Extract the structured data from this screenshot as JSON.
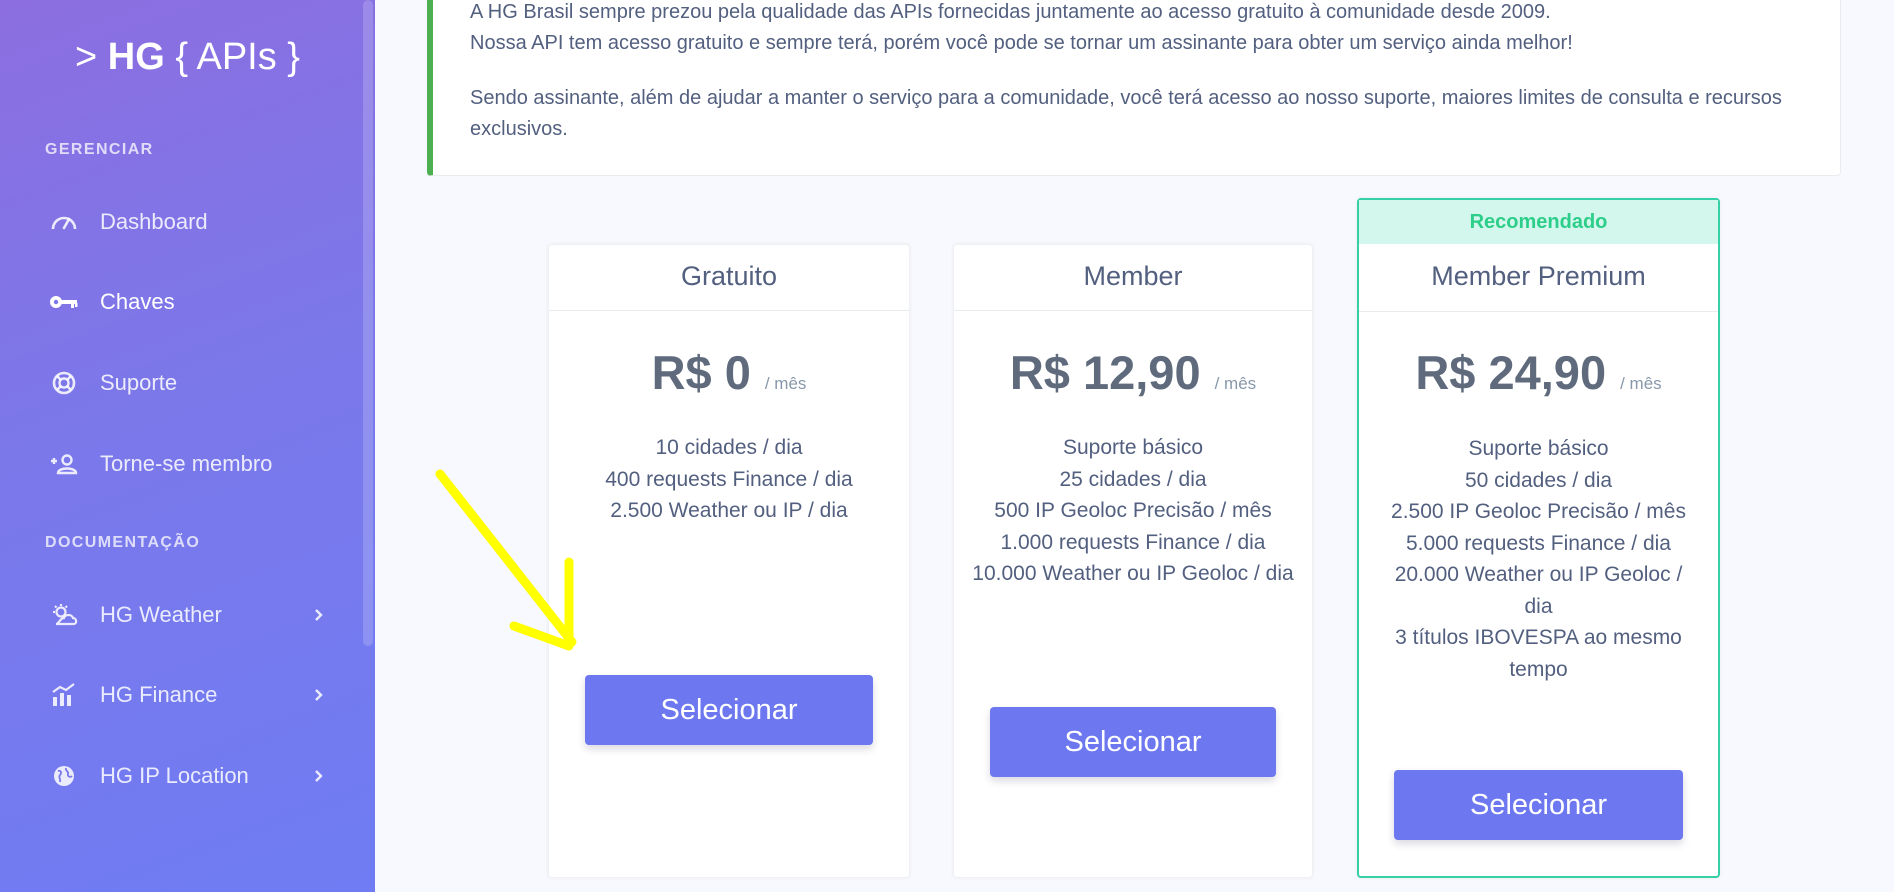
{
  "brand": {
    "prefix": ">",
    "name": "HG",
    "suffix": "{ APIs }"
  },
  "sidebar": {
    "sections": [
      {
        "heading": "GERENCIAR"
      },
      {
        "heading": "DOCUMENTAÇÃO"
      }
    ],
    "items": [
      {
        "label": "Dashboard",
        "icon": "speedometer-icon",
        "active": false
      },
      {
        "label": "Chaves",
        "icon": "key-icon",
        "active": true
      },
      {
        "label": "Suporte",
        "icon": "lifebuoy-icon",
        "active": false
      },
      {
        "label": "Torne-se membro",
        "icon": "user-plus-icon",
        "active": false
      },
      {
        "label": "HG Weather",
        "icon": "weather-icon",
        "expandable": true
      },
      {
        "label": "HG Finance",
        "icon": "finance-chart-icon",
        "expandable": true
      },
      {
        "label": "HG IP Location",
        "icon": "globe-icon",
        "expandable": true
      }
    ]
  },
  "alert": {
    "line1": "A HG Brasil sempre prezou pela qualidade das APIs fornecidas juntamente ao acesso gratuito à comunidade desde 2009.",
    "line2": "Nossa API tem acesso gratuito e sempre terá, porém você pode se tornar um assinante para obter um serviço ainda melhor!",
    "paragraph2": "Sendo assinante, além de ajudar a manter o serviço para a comunidade, você terá acesso ao nosso suporte, maiores limites de consulta e recursos exclusivos."
  },
  "plans": [
    {
      "name": "Gratuito",
      "price": "R$ 0",
      "period": "/ mês",
      "features": [
        "10 cidades / dia",
        "400 requests Finance / dia",
        "2.500 Weather ou IP / dia"
      ],
      "button": "Selecionar",
      "recommended": false
    },
    {
      "name": "Member",
      "price": "R$ 12,90",
      "period": "/ mês",
      "features": [
        "Suporte básico",
        "25 cidades / dia",
        "500 IP Geoloc Precisão / mês",
        "1.000 requests Finance / dia",
        "10.000 Weather ou IP Geoloc / dia"
      ],
      "button": "Selecionar",
      "recommended": false
    },
    {
      "name": "Member Premium",
      "price": "R$ 24,90",
      "period": "/ mês",
      "features": [
        "Suporte básico",
        "50 cidades / dia",
        "2.500 IP Geoloc Precisão / mês",
        "5.000 requests Finance / dia",
        "20.000 Weather ou IP Geoloc / dia",
        "3 títulos IBOVESPA ao mesmo tempo"
      ],
      "button": "Selecionar",
      "recommended": true,
      "ribbon": "Recomendado"
    }
  ],
  "colors": {
    "sidebar_gradient_start": "#8c6ee0",
    "sidebar_gradient_end": "#6f7cf3",
    "primary_button": "#6d78f0",
    "alert_border": "#4caf50",
    "recommended_green": "#2dce89",
    "annotation_arrow": "#ffff00"
  }
}
